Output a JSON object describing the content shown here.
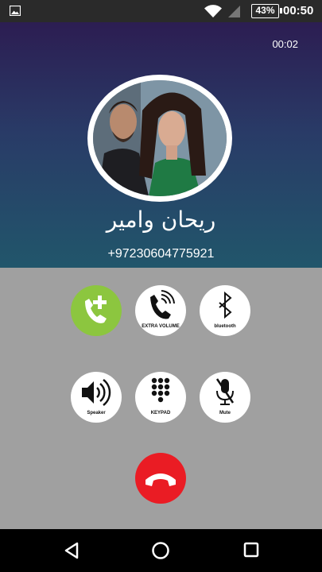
{
  "status_bar": {
    "battery": "43%",
    "time": "00:50",
    "icons": [
      "gallery-icon",
      "wifi-icon",
      "signal-icon",
      "battery-icon"
    ]
  },
  "call": {
    "duration": "00:02",
    "contact_name": "ريحان وامير",
    "phone_number": "+97230604775921"
  },
  "controls": {
    "add_call_icon": "add-call-icon",
    "extra_volume_label": "EXTRA VOLUME",
    "bluetooth_label": "bluetooth",
    "speaker_label": "Speaker",
    "keypad_label": "KEYPAD",
    "mute_label": "Mute",
    "end_call_icon": "end-call-icon"
  },
  "colors": {
    "add_call": "#8cc63f",
    "end_call": "#ea1c24",
    "header_top": "#2c1d52",
    "header_bottom": "#21566b",
    "panel": "#a0a0a0"
  },
  "nav_bar": {
    "icons": [
      "back-icon",
      "home-icon",
      "recents-icon"
    ]
  }
}
